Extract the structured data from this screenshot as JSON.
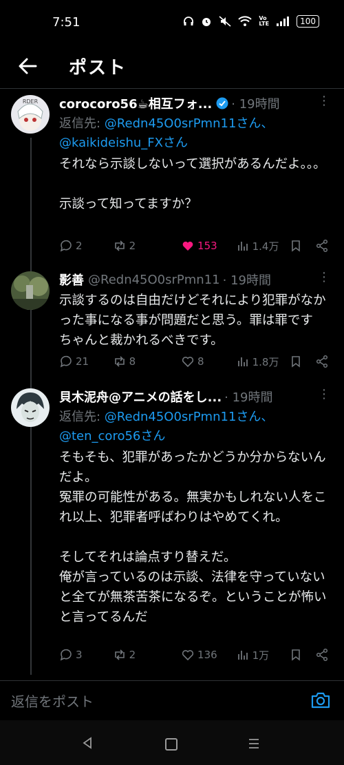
{
  "status": {
    "time": "7:51",
    "battery": "100",
    "icons": [
      "headphones-icon",
      "alarm-icon",
      "mute-icon",
      "wifi-icon",
      "volte-icon",
      "signal-icon",
      "battery-icon"
    ]
  },
  "header": {
    "title": "ポスト"
  },
  "posts": [
    {
      "name": "corocoro56☕相互フォ...",
      "handle": "",
      "time": "· 19時間",
      "reply_prefix": "返信先: ",
      "reply_users": "@Redn45O0srPmn11さん、\n@kaikideishu_FXさん",
      "text": "それなら示談しないって選択があるんだよ。。。\n\n示談って知ってますか？",
      "replies": "2",
      "reposts": "2",
      "likes": "153",
      "views": "1.4万"
    },
    {
      "name": "影善",
      "handle": "@Redn45O0srPmn11",
      "time": "· 19時間",
      "text": "示談するのは自由だけどそれにより犯罪がなかった事になる事が問題だと思う。罪は罪です　ちゃんと裁かれるべきです。",
      "replies": "21",
      "reposts": "8",
      "likes": "8",
      "views": "1.8万"
    },
    {
      "name": "貝木泥舟@アニメの話をし...",
      "handle": "",
      "time": "· 19時間",
      "reply_prefix": "返信先: ",
      "reply_users": "@Redn45O0srPmn11さん、\n@ten_coro56さん",
      "text": "そもそも、犯罪があったかどうか分からないんだよ。\n冤罪の可能性がある。無実かもしれない人をこれ以上、犯罪者呼ばわりはやめてくれ。\n\nそしてそれは論点すり替えだ。\n俺が言っているのは示談、法律を守っていないと全てが無茶苦茶になるぞ。ということが怖いと言ってるんだ",
      "replies": "3",
      "reposts": "2",
      "likes": "136",
      "views": "1万"
    }
  ],
  "reply_bar": {
    "placeholder": "返信をポスト"
  },
  "colors": {
    "accent": "#1d9bf0",
    "like": "#f91880",
    "muted": "#71767b"
  }
}
